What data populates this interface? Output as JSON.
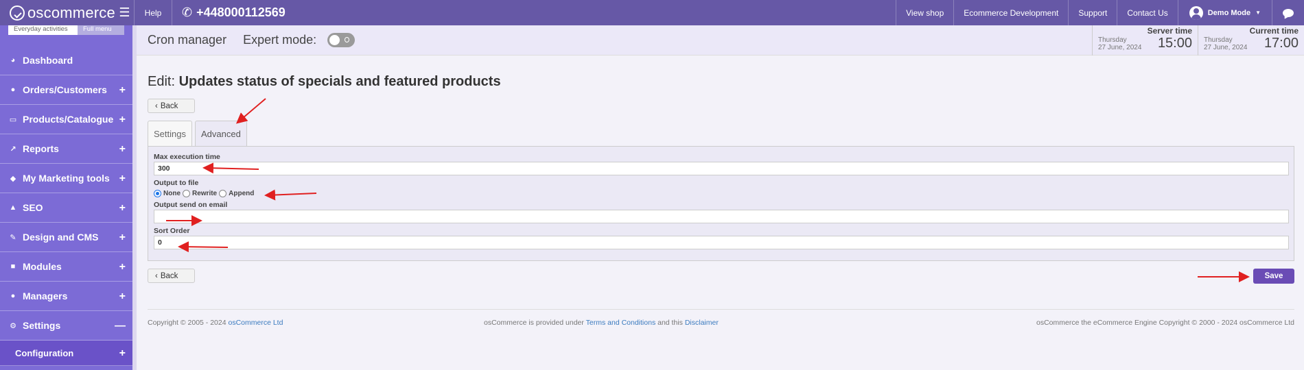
{
  "topbar": {
    "logo_text": "oscommerce",
    "help_label": "Help",
    "phone": "+448000112569",
    "nav": [
      "View shop",
      "Ecommerce Development",
      "Support",
      "Contact Us"
    ],
    "user_label": "Demo Mode"
  },
  "sidebar": {
    "tabs": [
      "Everyday activities",
      "Full menu"
    ],
    "items": [
      {
        "label": "Dashboard",
        "icon": "dashboard-icon"
      },
      {
        "label": "Orders/Customers",
        "icon": "users-icon"
      },
      {
        "label": "Products/Catalogue",
        "icon": "folder-icon"
      },
      {
        "label": "Reports",
        "icon": "chart-icon"
      },
      {
        "label": "My Marketing tools",
        "icon": "tag-icon"
      },
      {
        "label": "SEO",
        "icon": "sitemap-icon"
      },
      {
        "label": "Design and CMS",
        "icon": "brush-icon"
      },
      {
        "label": "Modules",
        "icon": "puzzle-icon"
      },
      {
        "label": "Managers",
        "icon": "user-icon"
      },
      {
        "label": "Settings",
        "icon": "gear-icon"
      }
    ],
    "subitem": "Configuration"
  },
  "subheader": {
    "title": "Cron manager",
    "expert_label": "Expert mode:",
    "server_time": {
      "label": "Server time",
      "day": "Thursday",
      "date": "27 June, 2024",
      "time": "15:00"
    },
    "current_time": {
      "label": "Current time",
      "day": "Thursday",
      "date": "27 June, 2024",
      "time": "17:00"
    }
  },
  "main": {
    "edit_prefix": "Edit:",
    "edit_title": "Updates status of specials and featured products",
    "back_label": "Back",
    "tabs": [
      "Settings",
      "Advanced"
    ],
    "fields": {
      "max_exec_label": "Max execution time",
      "max_exec_value": "300",
      "output_file_label": "Output to file",
      "radio_options": [
        "None",
        "Rewrite",
        "Append"
      ],
      "selected_option": "None",
      "email_label": "Output send on email",
      "email_value": "",
      "sort_label": "Sort Order",
      "sort_value": "0"
    },
    "save_label": "Save"
  },
  "footer": {
    "left_text": "Copyright © 2005 - 2024 ",
    "left_link": "osCommerce Ltd",
    "mid_text1": "osCommerce is provided under ",
    "mid_link1": "Terms and Conditions",
    "mid_text2": " and this ",
    "mid_link2": "Disclaimer",
    "right_text": "osCommerce the eCommerce Engine Copyright © 2000 - 2024 osCommerce Ltd"
  },
  "colors": {
    "brand": "#6658a6",
    "sidebar": "#7c6bd6",
    "save": "#6a4cb5",
    "annotation_arrow": "#e02020"
  }
}
